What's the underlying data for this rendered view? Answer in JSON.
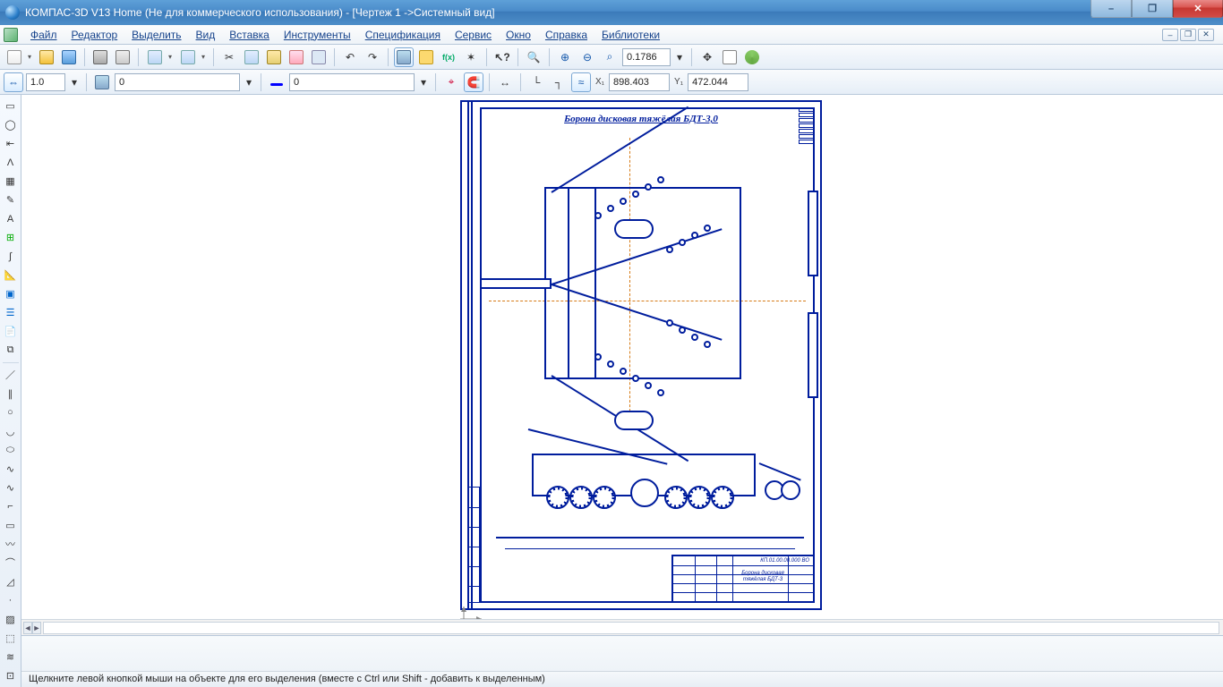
{
  "title": "КОМПАС-3D V13 Home (Не для коммерческого использования) - [Чертеж 1 ->Системный вид]",
  "menu": {
    "file": "Файл",
    "editor": "Редактор",
    "select": "Выделить",
    "view": "Вид",
    "insert": "Вставка",
    "tools": "Инструменты",
    "spec": "Спецификация",
    "service": "Сервис",
    "window": "Окно",
    "help": "Справка",
    "libs": "Библиотеки"
  },
  "toolbar1": {
    "zoom_value": "0.1786"
  },
  "toolbar2": {
    "step": "1.0",
    "layer_state": "0",
    "style_index": "0",
    "coord_x_label": "X₁",
    "coord_x": "898.403",
    "coord_y_label": "Y₁",
    "coord_y": "472.044"
  },
  "drawing": {
    "title": "Борона дисковая тяжёлая БДТ-3,0",
    "designation": "КП.01.00.00.000 ВО",
    "name_line1": "Борона дисковая",
    "name_line2": "тяжёлая БДТ-3"
  },
  "status": "Щелкните левой кнопкой мыши на объекте для его выделения (вместе с Ctrl или Shift - добавить к выделенным)"
}
